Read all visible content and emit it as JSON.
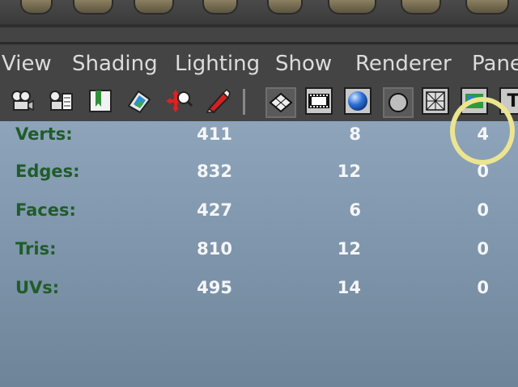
{
  "menubar": {
    "items": [
      "View",
      "Shading",
      "Lighting",
      "Show",
      "Renderer",
      "Pane"
    ]
  },
  "toolbar": {
    "icons": [
      "camera-icon",
      "camera-attributes-icon",
      "bookmark-icon",
      "image-plane-icon",
      "select-camera-icon",
      "pencil-icon",
      "grid-icon",
      "film-gate-icon",
      "smooth-shade-icon",
      "wireframe-on-shaded-icon",
      "xray-icon",
      "texture-icon",
      "text-icon"
    ]
  },
  "hud": {
    "rows": [
      {
        "label": "Verts:",
        "c1": "411",
        "c2": "8",
        "c3": "4"
      },
      {
        "label": "Edges:",
        "c1": "832",
        "c2": "12",
        "c3": "0"
      },
      {
        "label": "Faces:",
        "c1": "427",
        "c2": "6",
        "c3": "0"
      },
      {
        "label": "Tris:",
        "c1": "810",
        "c2": "12",
        "c3": "0"
      },
      {
        "label": "UVs:",
        "c1": "495",
        "c2": "14",
        "c3": "0"
      }
    ]
  },
  "colors": {
    "label_green": "#1f5c2a",
    "highlight": "#ece590",
    "viewport_top": "#8ea4bb",
    "viewport_bottom": "#6e8499"
  }
}
